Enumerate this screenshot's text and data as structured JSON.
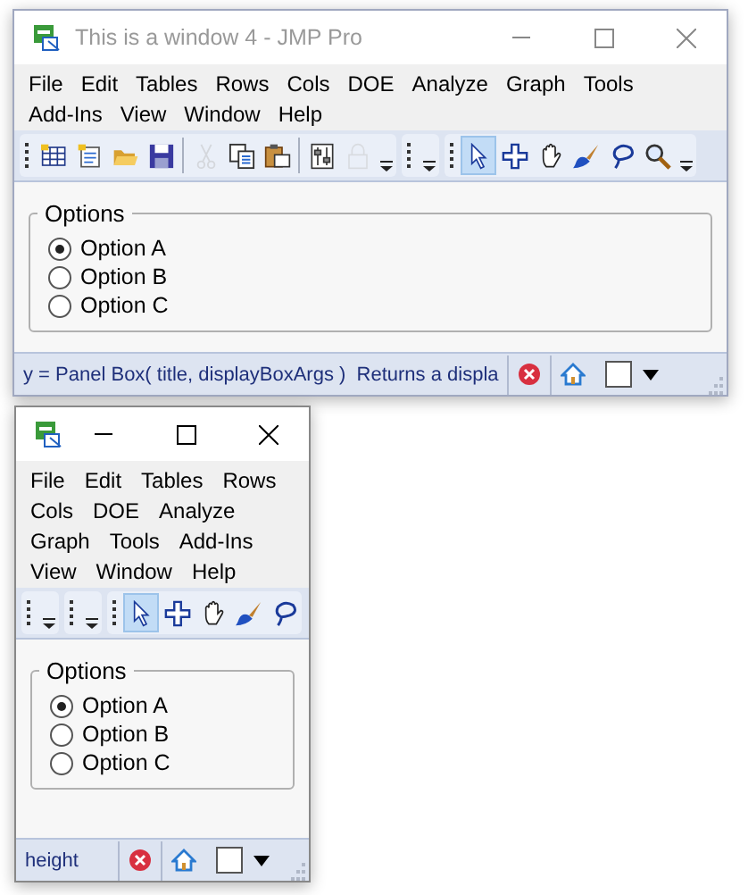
{
  "windows": [
    {
      "title": "This is a window 4 - JMP Pro",
      "menu": [
        "File",
        "Edit",
        "Tables",
        "Rows",
        "Cols",
        "DOE",
        "Analyze",
        "Graph",
        "Tools",
        "Add-Ins",
        "View",
        "Window",
        "Help"
      ],
      "toolbars": [
        {
          "overflow_menu": true,
          "groups": [
            {
              "tools": [
                {
                  "kind": "new-table",
                  "disabled": false,
                  "selected": false
                },
                {
                  "kind": "new-script",
                  "disabled": false,
                  "selected": false
                },
                {
                  "kind": "open",
                  "disabled": false,
                  "selected": false
                },
                {
                  "kind": "save",
                  "disabled": false,
                  "selected": false
                }
              ]
            },
            {
              "tools": [
                {
                  "kind": "cut",
                  "disabled": true,
                  "selected": false
                },
                {
                  "kind": "copy",
                  "disabled": false,
                  "selected": false
                },
                {
                  "kind": "paste",
                  "disabled": false,
                  "selected": false
                }
              ]
            },
            {
              "tools": [
                {
                  "kind": "sliders",
                  "disabled": false,
                  "selected": false
                },
                {
                  "kind": "lock",
                  "disabled": true,
                  "selected": false
                }
              ]
            }
          ]
        },
        {
          "overflow_menu": true
        },
        {
          "overflow_menu": true,
          "groups": [
            {
              "tools": [
                {
                  "kind": "arrow",
                  "disabled": false,
                  "selected": true
                },
                {
                  "kind": "crosshair",
                  "disabled": false,
                  "selected": false
                },
                {
                  "kind": "hand",
                  "disabled": false,
                  "selected": false
                },
                {
                  "kind": "brush",
                  "disabled": false,
                  "selected": false
                },
                {
                  "kind": "lasso",
                  "disabled": false,
                  "selected": false
                },
                {
                  "kind": "magnifier",
                  "disabled": false,
                  "selected": false
                }
              ]
            }
          ]
        }
      ],
      "panel": {
        "title": "Options",
        "options": [
          {
            "label": "Option A",
            "selected": true
          },
          {
            "label": "Option B",
            "selected": false
          },
          {
            "label": "Option C",
            "selected": false
          }
        ]
      },
      "status": {
        "text": "y = Panel Box( title, displayBoxArgs )  Returns a displa",
        "checked": false
      }
    },
    {
      "menu": [
        "File",
        "Edit",
        "Tables",
        "Rows",
        "Cols",
        "DOE",
        "Analyze",
        "Graph",
        "Tools",
        "Add-Ins",
        "View",
        "Window",
        "Help"
      ],
      "toolbars": [
        {
          "overflow_menu": true
        },
        {
          "overflow_menu": true
        },
        {
          "overflow_menu": false,
          "groups": [
            {
              "tools": [
                {
                  "kind": "arrow",
                  "disabled": false,
                  "selected": true
                },
                {
                  "kind": "crosshair",
                  "disabled": false,
                  "selected": false
                },
                {
                  "kind": "hand",
                  "disabled": false,
                  "selected": false
                },
                {
                  "kind": "brush",
                  "disabled": false,
                  "selected": false
                },
                {
                  "kind": "lasso",
                  "disabled": false,
                  "selected": false
                }
              ]
            }
          ]
        }
      ],
      "panel": {
        "title": "Options",
        "options": [
          {
            "label": "Option A",
            "selected": true
          },
          {
            "label": "Option B",
            "selected": false
          },
          {
            "label": "Option C",
            "selected": false
          }
        ]
      },
      "status": {
        "text": "height",
        "checked": false
      }
    }
  ]
}
